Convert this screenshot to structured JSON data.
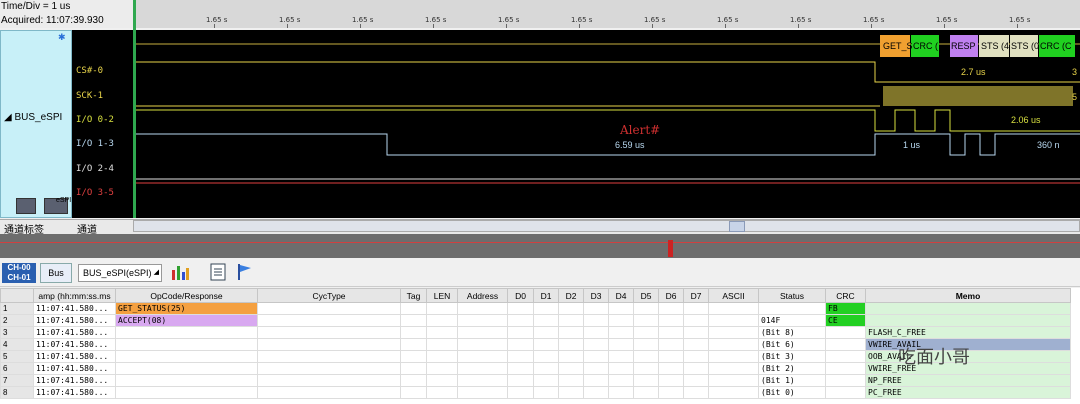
{
  "header": {
    "time_div": "Time/Div = 1 us",
    "acquired": "Acquired: 11:07:39.930"
  },
  "ruler": {
    "ticks": [
      "1.65 s",
      "1.65 s",
      "1.65 s",
      "1.65 s",
      "1.65 s",
      "1.65 s",
      "1.65 s",
      "1.65 s",
      "1.65 s",
      "1.65 s",
      "1.65 s",
      "1.65 s"
    ]
  },
  "group": {
    "name": "BUS_eSPI",
    "icon2_label": "eSPI"
  },
  "channels": [
    {
      "label": "CS#-0",
      "color": "#e8d44a"
    },
    {
      "label": "SCK-1",
      "color": "#e8d44a"
    },
    {
      "label": "I/O 0-2",
      "color": "#d8e040"
    },
    {
      "label": "I/O 1-3",
      "color": "#b8d8f0"
    },
    {
      "label": "I/O 2-4",
      "color": "#e0e0e0"
    },
    {
      "label": "I/O 3-5",
      "color": "#e04040"
    }
  ],
  "waveform": {
    "packets": [
      "GET_S",
      "CRC (",
      "RESP",
      "STS (4",
      "STS (0",
      "CRC (C"
    ],
    "measurements": {
      "cs": "2.7 us",
      "cs_edge": "3",
      "sck_edge": "5",
      "io0": "2.06 us",
      "io1_gap": "6.59 us",
      "io1_a": "1 us",
      "io1_b": "360 n"
    },
    "alert": "Alert#"
  },
  "bottombar": {
    "label_col": "通道标签",
    "channel_col": "通道"
  },
  "toolbar": {
    "ch_top": "CH-00",
    "ch_bottom": "CH-01",
    "bus": "Bus",
    "bus_name": "BUS_eSPI(eSPI)"
  },
  "table": {
    "columns": [
      "",
      "amp (hh:mm:ss.ms",
      "OpCode/Response",
      "CycType",
      "Tag",
      "LEN",
      "Address",
      "D0",
      "D1",
      "D2",
      "D3",
      "D4",
      "D5",
      "D6",
      "D7",
      "ASCII",
      "Status",
      "CRC",
      "Memo"
    ],
    "rows": [
      {
        "n": "1",
        "time": "11:07:41.580...",
        "op": "GET_STATUS(25)",
        "op_color": "#f4a040",
        "status": "",
        "crc": "FB",
        "memo": ""
      },
      {
        "n": "2",
        "time": "11:07:41.580...",
        "op": "ACCEPT(08)",
        "op_color": "#d8a8f0",
        "status": "014F",
        "crc": "CE",
        "memo": ""
      },
      {
        "n": "3",
        "time": "11:07:41.580...",
        "op": "",
        "op_color": "",
        "status": "(Bit 8)",
        "crc": "",
        "memo": "FLASH_C_FREE"
      },
      {
        "n": "4",
        "time": "11:07:41.580...",
        "op": "",
        "op_color": "",
        "status": "(Bit 6)",
        "crc": "",
        "memo": "VWIRE_AVAIL"
      },
      {
        "n": "5",
        "time": "11:07:41.580...",
        "op": "",
        "op_color": "",
        "status": "(Bit 3)",
        "crc": "",
        "memo": "OOB_AVAIL"
      },
      {
        "n": "6",
        "time": "11:07:41.580...",
        "op": "",
        "op_color": "",
        "status": "(Bit 2)",
        "crc": "",
        "memo": "VWIRE_FREE"
      },
      {
        "n": "7",
        "time": "11:07:41.580...",
        "op": "",
        "op_color": "",
        "status": "(Bit 1)",
        "crc": "",
        "memo": "NP_FREE"
      },
      {
        "n": "8",
        "time": "11:07:41.580...",
        "op": "",
        "op_color": "",
        "status": "(Bit 0)",
        "crc": "",
        "memo": "PC_FREE"
      }
    ]
  },
  "watermark": "吃面小哥"
}
